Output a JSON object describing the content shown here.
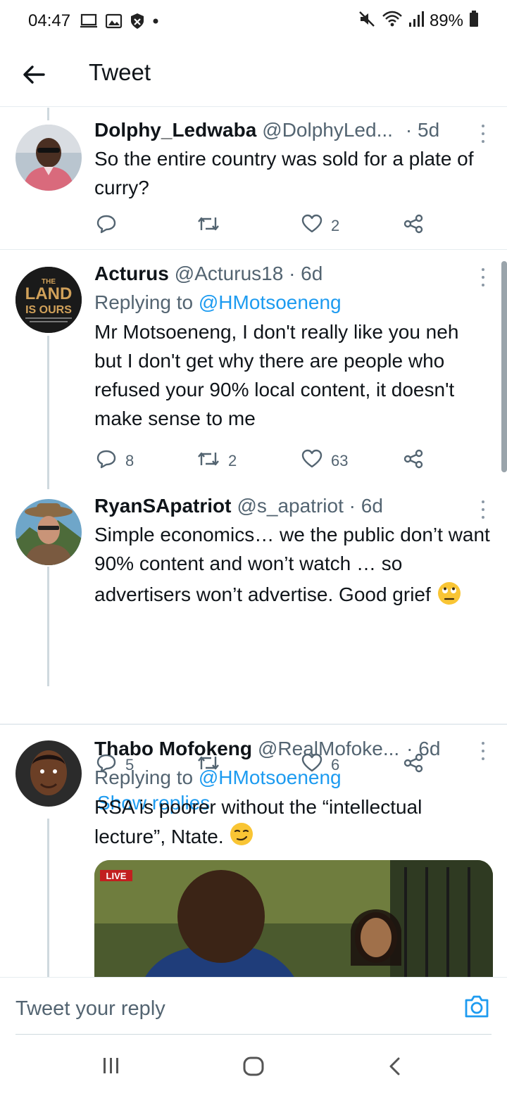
{
  "status": {
    "time": "04:47",
    "battery": "89%"
  },
  "header": {
    "title": "Tweet"
  },
  "tweets": [
    {
      "name": "Dolphy_Ledwaba",
      "handle": "@DolphyLed...",
      "time": "· 5d",
      "text": "So the entire country was sold for a plate of curry?",
      "replies": "",
      "retweets": "",
      "likes": "2"
    },
    {
      "name": "Acturus",
      "handle": "@Acturus18 · 6d",
      "time": "",
      "replying_prefix": "Replying to ",
      "replying_to": "@HMotsoeneng",
      "text": "Mr Motsoeneng, I don't really like you neh but I don't get why there are people who refused your 90% local content, it doesn't make sense to me",
      "replies": "8",
      "retweets": "2",
      "likes": "63",
      "avatar_text": [
        "THE",
        "LAND",
        "IS OURS"
      ]
    },
    {
      "name": "RyanSApatriot",
      "handle": "@s_apatriot · 6d",
      "time": "",
      "text": "Simple economics… we the public don’t want 90% content and won’t watch … so advertisers won’t advertise. Good grief",
      "replies": "5",
      "retweets": "",
      "likes": "6",
      "show_replies": "Show replies"
    },
    {
      "name": "Thabo Mofokeng",
      "handle": "@RealMofoke...",
      "time": "· 6d",
      "replying_prefix": "Replying to ",
      "replying_to": "@HMotsoeneng",
      "text": "RSA is poorer without the “intellectual lecture”, Ntate.",
      "media_badge": "LIVE"
    }
  ],
  "reply_bar": {
    "placeholder": "Tweet your reply"
  },
  "colors": {
    "accent": "#1d9bf0",
    "text": "#0f1419",
    "muted": "#536471"
  }
}
